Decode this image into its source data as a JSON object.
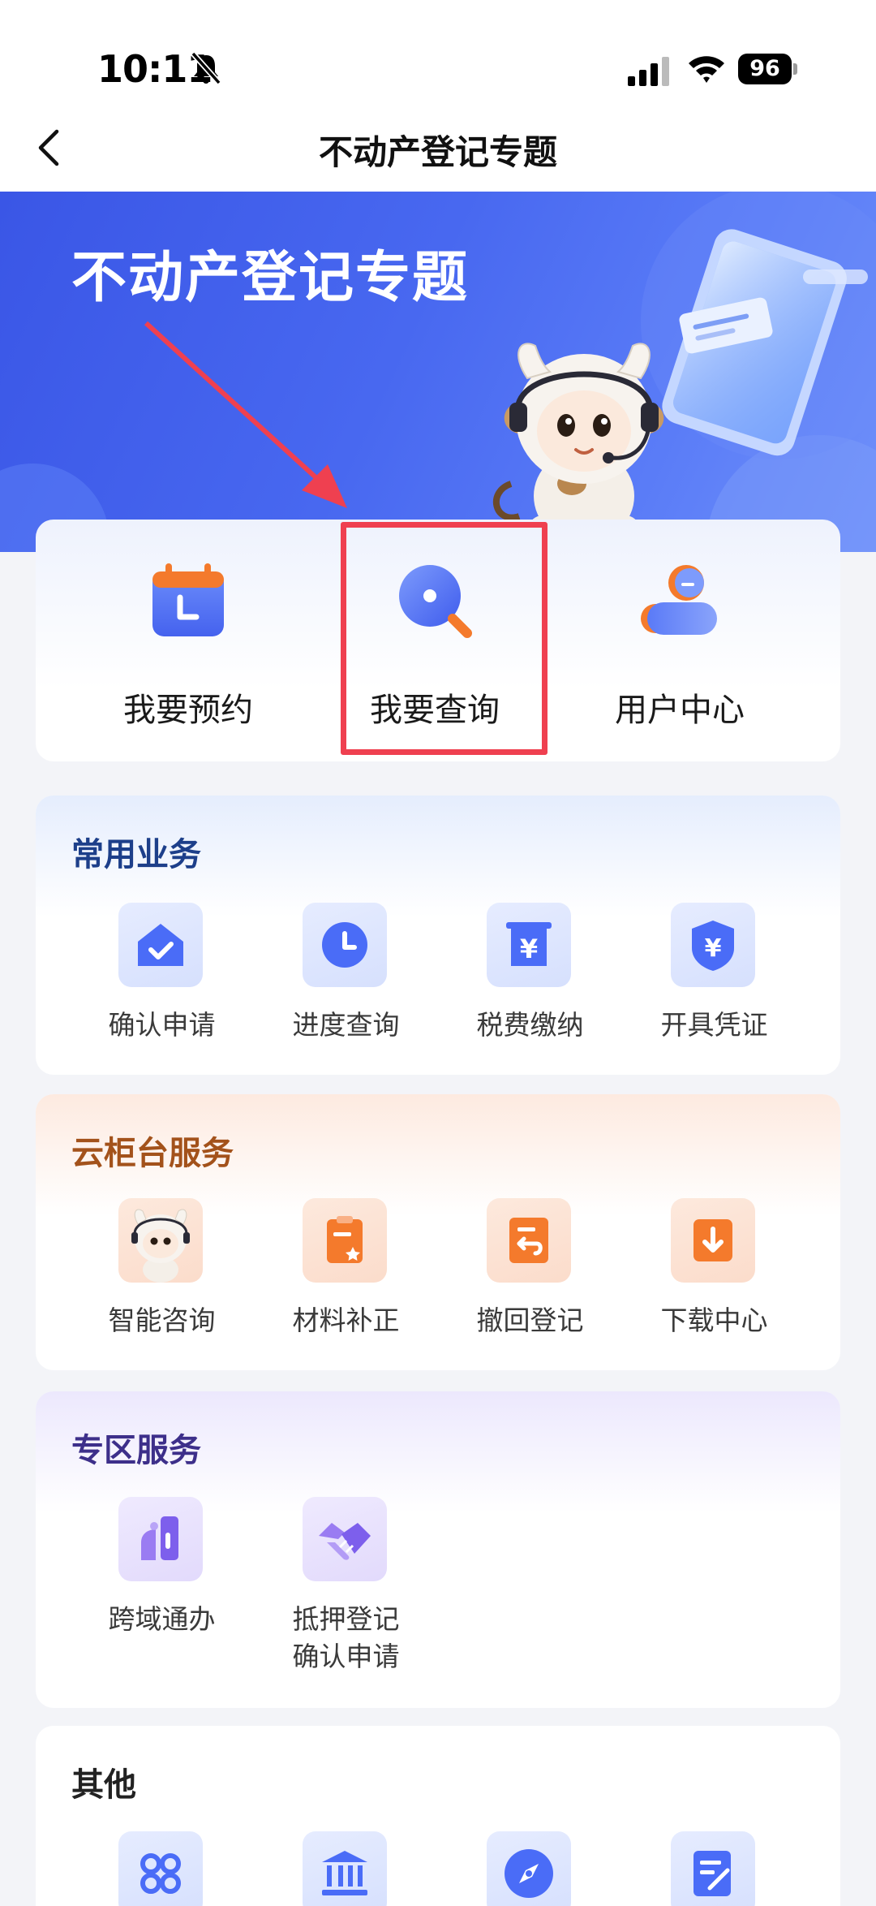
{
  "status_bar": {
    "time": "10:11",
    "battery": "96"
  },
  "nav": {
    "title": "不动产登记专题"
  },
  "banner": {
    "title": "不动产登记专题"
  },
  "quick_actions": [
    {
      "label": "我要预约",
      "icon": "calendar-icon"
    },
    {
      "label": "我要查询",
      "icon": "search-icon"
    },
    {
      "label": "用户中心",
      "icon": "user-icon"
    }
  ],
  "sections": {
    "common": {
      "title": "常用业务",
      "items": [
        {
          "label": "确认申请",
          "icon": "home-check-icon"
        },
        {
          "label": "进度查询",
          "icon": "clock-icon"
        },
        {
          "label": "税费缴纳",
          "icon": "yuan-receipt-icon"
        },
        {
          "label": "开具凭证",
          "icon": "yuan-shield-icon"
        }
      ]
    },
    "cloud": {
      "title": "云柜台服务",
      "items": [
        {
          "label": "智能咨询",
          "icon": "mascot-icon"
        },
        {
          "label": "材料补正",
          "icon": "clipboard-star-icon"
        },
        {
          "label": "撤回登记",
          "icon": "undo-doc-icon"
        },
        {
          "label": "下载中心",
          "icon": "download-icon"
        }
      ]
    },
    "zone": {
      "title": "专区服务",
      "items": [
        {
          "label": "跨域通办",
          "icon": "cross-region-icon"
        },
        {
          "label": "抵押登记",
          "label2": "确认申请",
          "icon": "handshake-icon"
        }
      ]
    },
    "other": {
      "title": "其他",
      "items": [
        {
          "icon": "grid-apps-icon"
        },
        {
          "icon": "bank-icon"
        },
        {
          "icon": "compass-icon"
        },
        {
          "icon": "edit-form-icon"
        }
      ]
    }
  },
  "colors": {
    "primary": "#4a6cf7",
    "accent_orange": "#f47a2c",
    "highlight": "#ef4050"
  }
}
